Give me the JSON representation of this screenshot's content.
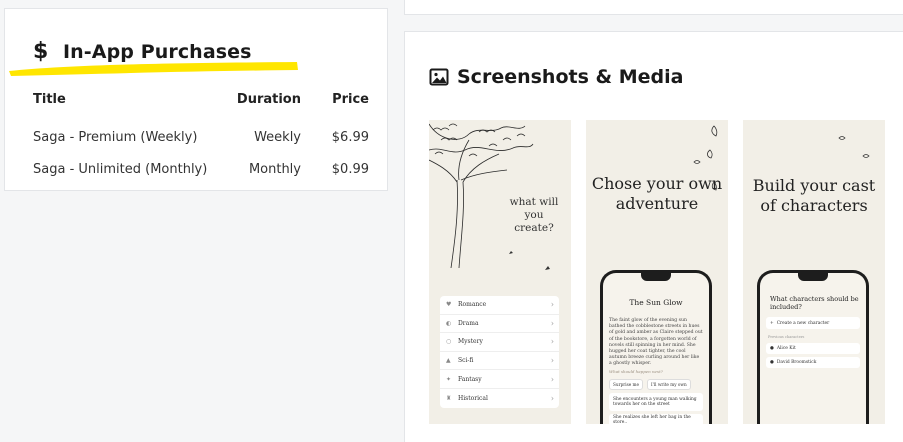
{
  "in_app_purchases": {
    "title": "In-App Purchases",
    "icon": "dollar-icon",
    "highlight_color": "#ffe600",
    "columns": [
      "Title",
      "Duration",
      "Price"
    ],
    "rows": [
      {
        "title": "Saga - Premium (Weekly)",
        "duration": "Weekly",
        "price": "$6.99"
      },
      {
        "title": "Saga - Unlimited (Monthly)",
        "duration": "Monthly",
        "price": "$0.99"
      }
    ]
  },
  "media": {
    "title": "Screenshots & Media",
    "icon": "image-icon",
    "screenshots": [
      {
        "headline": "what will you create?",
        "categories": [
          "Romance",
          "Drama",
          "Mystery",
          "Sci-fi",
          "Fantasy",
          "Historical"
        ]
      },
      {
        "headline": "Chose your own adventure",
        "screen_title": "The Sun Glow",
        "screen_body": "The faint glow of the evening sun bathed the cobblestone streets in hues of gold and amber as Claire stepped out of the bookstore, a forgotten world of novels still spinning in her mind. She hugged her coat tighter, the cool autumn breeze curling around her like a ghostly whisper.",
        "hint": "What should happen next?",
        "chips": [
          "Surprise me",
          "I'll write my own"
        ],
        "options": [
          "She encounters a young man walking towards her on the street",
          "She realizes she left her bag in the store.."
        ]
      },
      {
        "headline": "Build your cast of characters",
        "screen_question": "What characters should be included?",
        "create_label": "Create a new character",
        "section_label": "Previous characters",
        "characters": [
          "Alice Kit",
          "David Broomstick"
        ]
      }
    ]
  }
}
